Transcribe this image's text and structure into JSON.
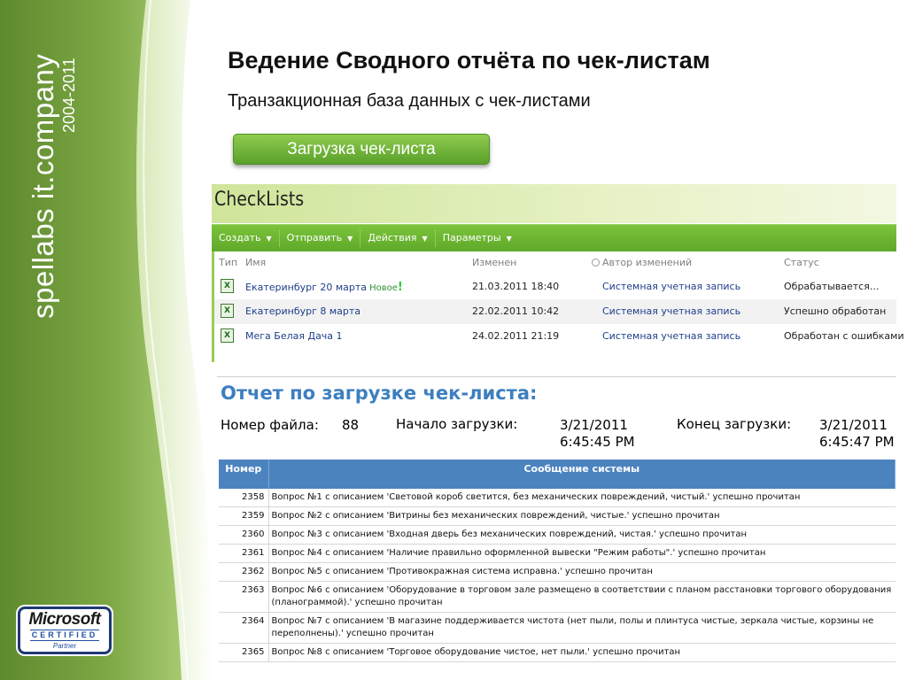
{
  "brand": {
    "company": "spellabs it.company",
    "years": "2004-2011",
    "badge": {
      "logo": "Microsoft",
      "certified": "CERTIFIED",
      "partner": "Partner"
    }
  },
  "slide": {
    "title": "Ведение Сводного отчёта по чек-листам",
    "subtitle": "Транзакционная база данных с чек-листами",
    "upload_button": "Загрузка чек-листа"
  },
  "checklists": {
    "title": "CheckLists",
    "toolbar": [
      "Создать",
      "Отправить",
      "Действия",
      "Параметры"
    ],
    "columns": {
      "type": "Тип",
      "name": "Имя",
      "modified": "Изменен",
      "author": "Автор изменений",
      "status": "Статус"
    },
    "new_label": "Новое",
    "new_mark": "!",
    "rows": [
      {
        "name": "Екатеринбург 20 марта",
        "modified": "21.03.2011 18:40",
        "author": "Системная учетная запись",
        "status": "Обрабатывается..."
      },
      {
        "name": "Екатеринбург 8 марта",
        "modified": "22.02.2011 10:42",
        "author": "Системная учетная запись",
        "status": "Успешно обработан"
      },
      {
        "name": "Мега Белая Дача 1",
        "modified": "24.02.2011 21:19",
        "author": "Системная учетная запись",
        "status": "Обработан с ошибками"
      }
    ]
  },
  "report": {
    "title": "Отчет по загрузке чек-листа:",
    "file_label": "Номер файла:",
    "file_value": "88",
    "start_label": "Начало загрузки:",
    "start_date": "3/21/2011",
    "start_time": "6:45:45 PM",
    "end_label": "Конец загрузки:",
    "end_date": "3/21/2011",
    "end_time": "6:45:47 PM",
    "headers": {
      "number": "Номер",
      "message": "Сообщение системы"
    },
    "rows": [
      {
        "number": "2358",
        "message": "Вопрос №1 с описанием 'Световой короб светится, без механических повреждений, чистый.' успешно прочитан"
      },
      {
        "number": "2359",
        "message": "Вопрос №2 с описанием 'Витрины без механических повреждений, чистые.' успешно прочитан"
      },
      {
        "number": "2360",
        "message": "Вопрос №3 с описанием 'Входная дверь без механических повреждений, чистая.' успешно прочитан"
      },
      {
        "number": "2361",
        "message": "Вопрос №4 с описанием 'Наличие правильно оформленной вывески \"Режим работы\".' успешно прочитан"
      },
      {
        "number": "2362",
        "message": "Вопрос №5 с описанием 'Противокражная система исправна.' успешно прочитан"
      },
      {
        "number": "2363",
        "message": "Вопрос №6 с описанием 'Оборудование в торговом зале размещено в соответствии с планом расстановки торгового оборудования (планограммой).' успешно прочитан"
      },
      {
        "number": "2364",
        "message": "Вопрос №7 с описанием 'В магазине поддерживается чистота (нет пыли, полы и плинтуса чистые, зеркала чистые, корзины не переполнены).' успешно прочитан"
      },
      {
        "number": "2365",
        "message": "Вопрос №8 с описанием 'Торговое оборудование чистое, нет пыли.' успешно прочитан"
      }
    ]
  }
}
